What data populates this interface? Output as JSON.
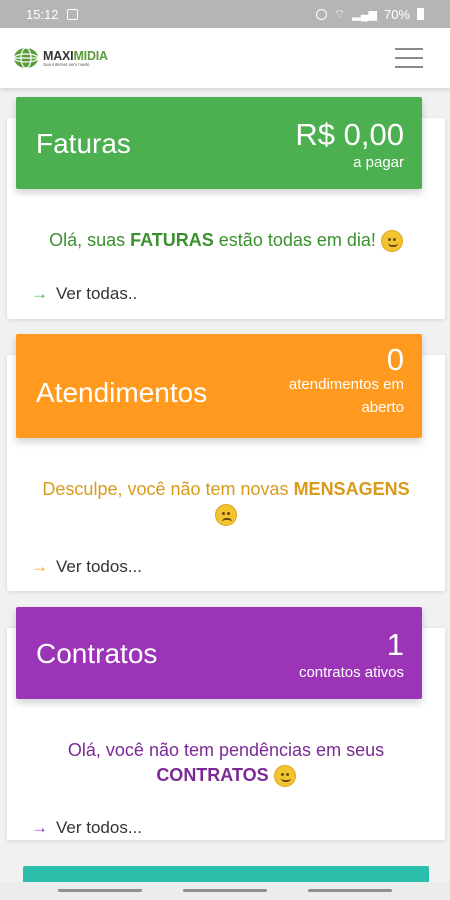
{
  "status_bar": {
    "time": "15:12",
    "battery": "70%"
  },
  "app": {
    "logo_main": "MAXI",
    "logo_accent": "MIDIA",
    "logo_tagline": "Sua internet sem medo",
    "menu_icon": "hamburger-menu-icon"
  },
  "faturas": {
    "title": "Faturas",
    "amount": "R$ 0,00",
    "amount_label": "a pagar",
    "msg_prefix": "Olá, suas ",
    "msg_bold": "FATURAS",
    "msg_suffix": " estão todas em dia! ",
    "link": "Ver todas..",
    "color": "#4caf50",
    "text_color": "#3a8f2e"
  },
  "atendimentos": {
    "title": "Atendimentos",
    "count": "0",
    "count_label_line1": "atendimentos em",
    "count_label_line2": "aberto",
    "msg_prefix": "Desculpe, você não tem novas ",
    "msg_bold": "MENSAGENS",
    "link": "Ver todos...",
    "color": "#ff9a1f",
    "text_color": "#d99a1a"
  },
  "contratos": {
    "title": "Contratos",
    "count": "1",
    "count_label": "contratos ativos",
    "msg_line1": "Olá, você não tem pendências em seus",
    "msg_bold": "CONTRATOS",
    "link": "Ver todos...",
    "color": "#9c34b8",
    "text_color": "#7b2a95"
  }
}
